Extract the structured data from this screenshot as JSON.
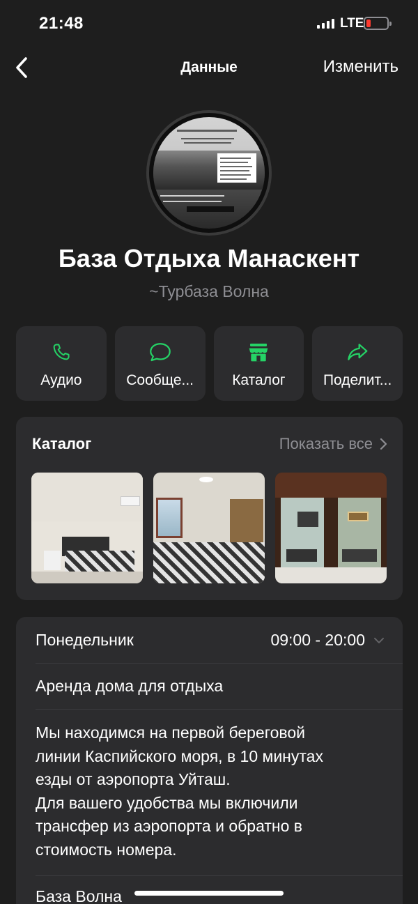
{
  "status_bar": {
    "time": "21:48",
    "network": "LTE"
  },
  "nav": {
    "title": "Данные",
    "edit_label": "Изменить"
  },
  "profile": {
    "name": "База Отдыха Манаскент",
    "subtitle": "~Турбаза Волна"
  },
  "actions": [
    {
      "label": "Аудио",
      "icon": "phone-icon"
    },
    {
      "label": "Сообще...",
      "icon": "message-icon"
    },
    {
      "label": "Каталог",
      "icon": "store-icon"
    },
    {
      "label": "Поделит...",
      "icon": "share-icon"
    }
  ],
  "catalog": {
    "title": "Каталог",
    "show_all": "Показать все"
  },
  "info": {
    "day": "Понедельник",
    "hours": "09:00 - 20:00",
    "category": "Аренда дома для отдыха",
    "description_lines": [
      "Мы находимся на первой береговой",
      "линии Каспийского моря, в 10 минутах",
      "езды от аэропорта Уйташ.",
      "Для вашего удобства мы включили",
      "трансфер из аэропорта и обратно в",
      "стоимость номера."
    ],
    "next_item": "База Волна"
  },
  "colors": {
    "accent": "#25d366",
    "background": "#1e1e1e",
    "card": "#2c2c2e",
    "secondary_text": "#8e8e93",
    "battery_low": "#ff3b30"
  }
}
